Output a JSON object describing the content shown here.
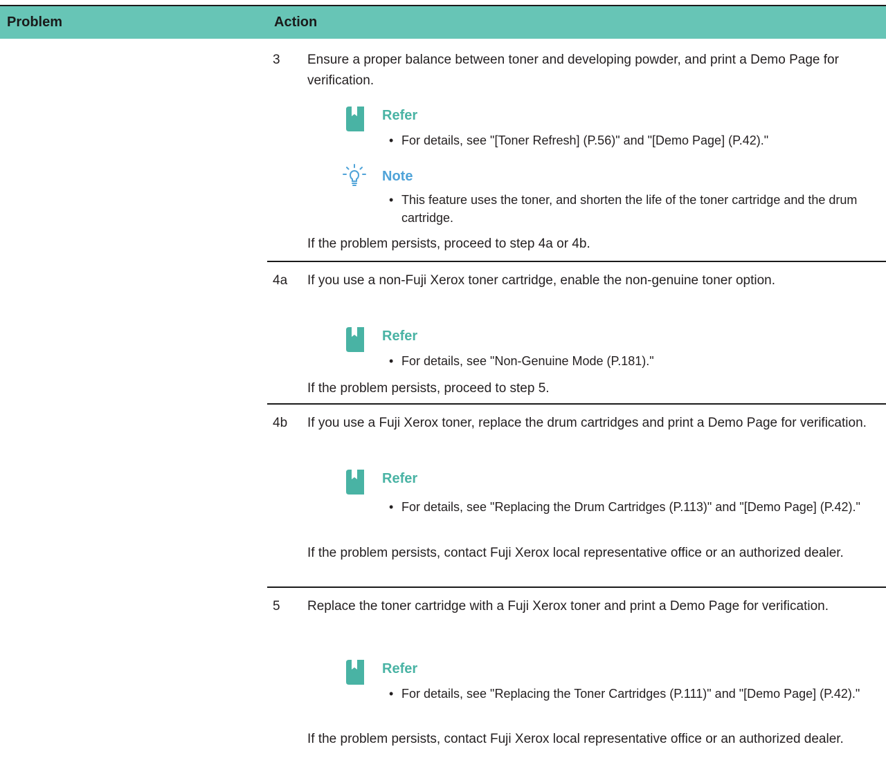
{
  "header": {
    "problem_label": "Problem",
    "action_label": "Action"
  },
  "rows": [
    {
      "step": "3",
      "text": "Ensure a proper balance between toner and developing powder, and print a Demo Page for verification.",
      "refer_label": "Refer",
      "refer_item": "For details, see \"[Toner Refresh] (P.56)\" and \"[Demo Page] (P.42).\"",
      "note_label": "Note",
      "note_item": "This feature uses the toner, and shorten the life of the toner cartridge and the drum cartridge.",
      "after": "If the problem persists, proceed to step 4a or 4b."
    },
    {
      "step": "4a",
      "text": "If you use a non-Fuji Xerox toner cartridge, enable the non-genuine  toner option.",
      "refer_label": "Refer",
      "refer_item": "For details, see \"Non-Genuine Mode (P.181).\"",
      "after": "If the problem persists, proceed to step 5."
    },
    {
      "step": "4b",
      "text": "If you use a Fuji Xerox toner, replace the drum cartridges and print a Demo Page for verification.",
      "refer_label": "Refer",
      "refer_item": "For details, see \"Replacing the Drum Cartridges (P.113)\" and \"[Demo Page] (P.42).\"",
      "after": "If the problem persists, contact Fuji Xerox local representative office or an authorized dealer."
    },
    {
      "step": "5",
      "text": "Replace the toner cartridge with a Fuji Xerox toner and print a Demo Page for verification.",
      "refer_label": "Refer",
      "refer_item": "For details, see \"Replacing the Toner Cartridges (P.111)\" and \"[Demo Page] (P.42).\"",
      "after": "If the problem persists, contact Fuji Xerox local representative office or an authorized dealer."
    }
  ],
  "colors": {
    "header_bg": "#67c5b6",
    "refer_accent": "#49b3a4",
    "note_accent": "#4fa3d8"
  },
  "icons": {
    "refer": "book-icon",
    "note": "lightbulb-icon"
  }
}
